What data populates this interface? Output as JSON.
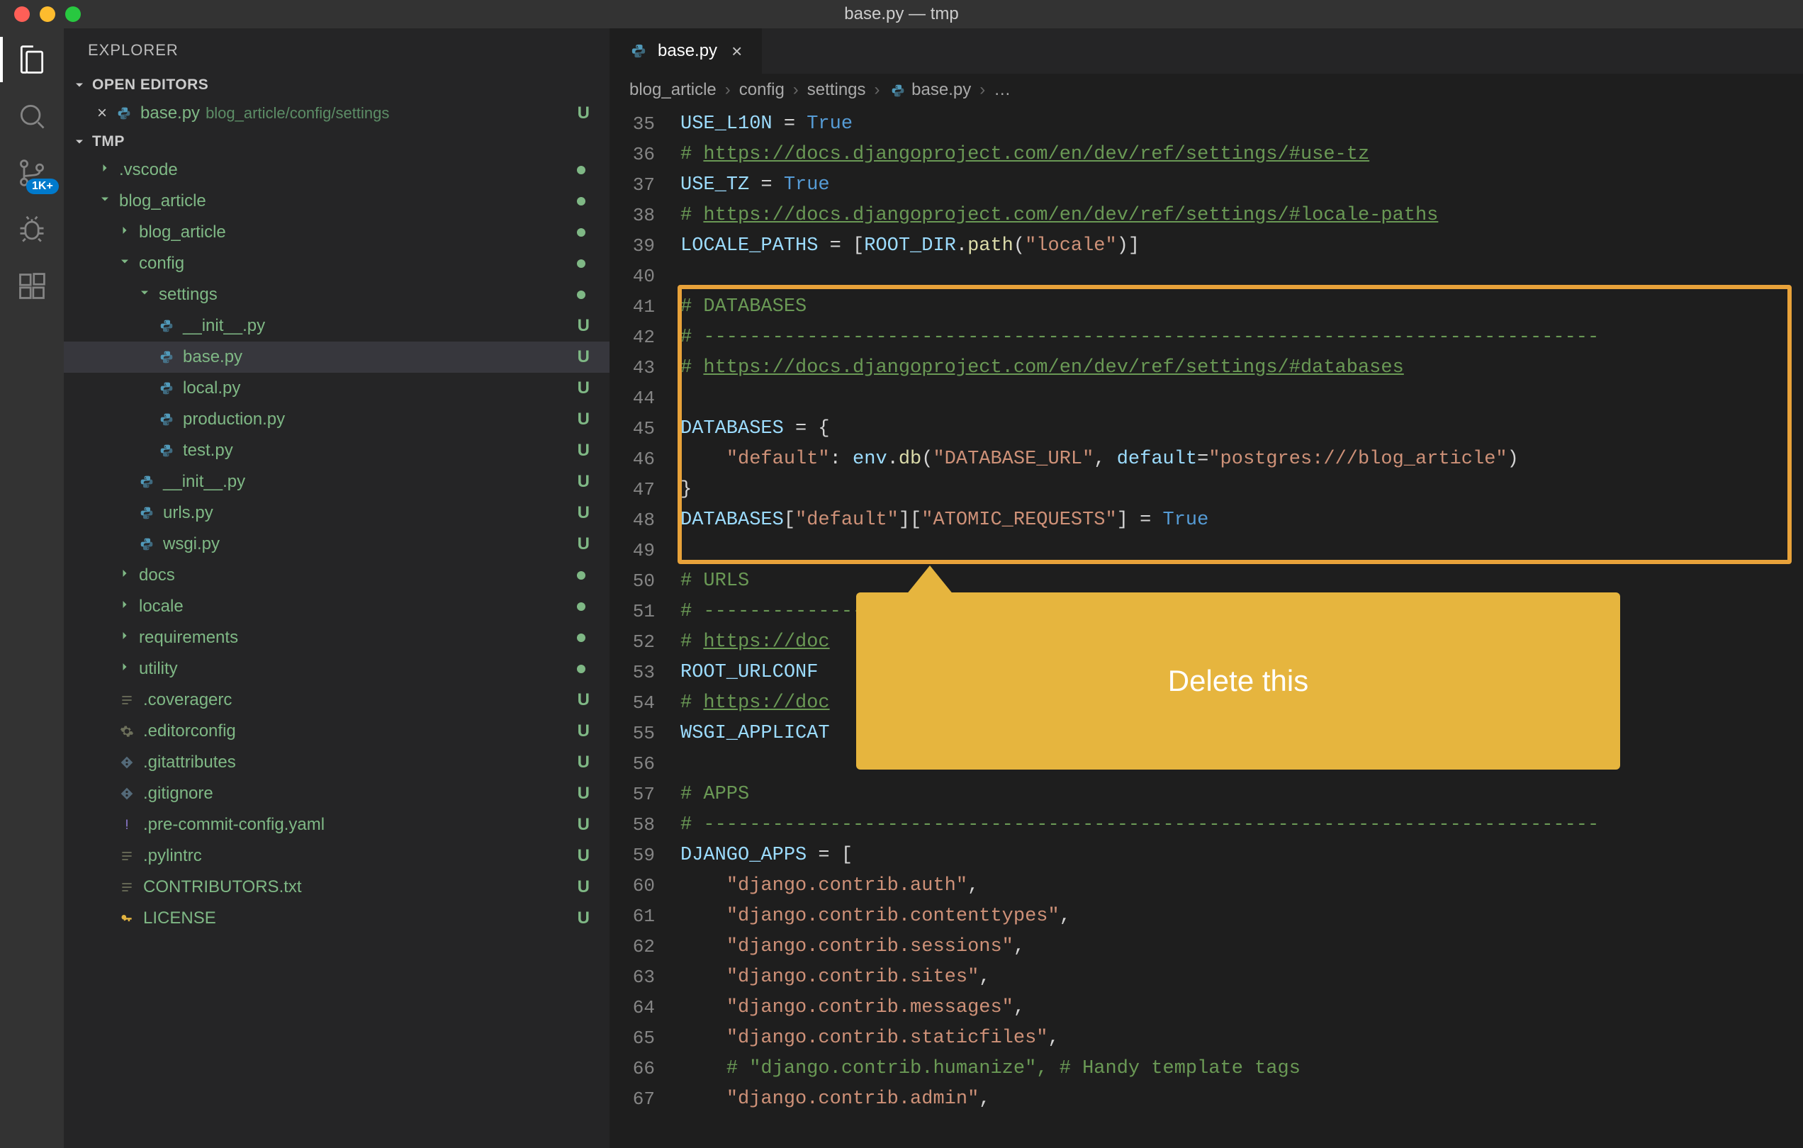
{
  "titlebar": {
    "title": "base.py — tmp"
  },
  "activity": {
    "badge_text": "1K+"
  },
  "sidebar": {
    "title": "EXPLORER",
    "open_editors_label": "OPEN EDITORS",
    "workspace_label": "TMP",
    "open_editor": {
      "name": "base.py",
      "path": "blog_article/config/settings",
      "status": "U"
    },
    "tree": [
      {
        "type": "folder",
        "name": ".vscode",
        "depth": 1,
        "expanded": false,
        "status_dot": true
      },
      {
        "type": "folder",
        "name": "blog_article",
        "depth": 1,
        "expanded": true,
        "status_dot": true
      },
      {
        "type": "folder",
        "name": "blog_article",
        "depth": 2,
        "expanded": false,
        "status_dot": true
      },
      {
        "type": "folder",
        "name": "config",
        "depth": 2,
        "expanded": true,
        "status_dot": true
      },
      {
        "type": "folder",
        "name": "settings",
        "depth": 3,
        "expanded": true,
        "status_dot": true
      },
      {
        "type": "file",
        "name": "__init__.py",
        "depth": 4,
        "icon": "py",
        "status": "U"
      },
      {
        "type": "file",
        "name": "base.py",
        "depth": 4,
        "icon": "py",
        "status": "U",
        "selected": true
      },
      {
        "type": "file",
        "name": "local.py",
        "depth": 4,
        "icon": "py",
        "status": "U"
      },
      {
        "type": "file",
        "name": "production.py",
        "depth": 4,
        "icon": "py",
        "status": "U"
      },
      {
        "type": "file",
        "name": "test.py",
        "depth": 4,
        "icon": "py",
        "status": "U"
      },
      {
        "type": "file",
        "name": "__init__.py",
        "depth": 3,
        "icon": "py",
        "status": "U"
      },
      {
        "type": "file",
        "name": "urls.py",
        "depth": 3,
        "icon": "py",
        "status": "U"
      },
      {
        "type": "file",
        "name": "wsgi.py",
        "depth": 3,
        "icon": "py",
        "status": "U"
      },
      {
        "type": "folder",
        "name": "docs",
        "depth": 2,
        "expanded": false,
        "status_dot": true
      },
      {
        "type": "folder",
        "name": "locale",
        "depth": 2,
        "expanded": false,
        "status_dot": true
      },
      {
        "type": "folder",
        "name": "requirements",
        "depth": 2,
        "expanded": false,
        "status_dot": true
      },
      {
        "type": "folder",
        "name": "utility",
        "depth": 2,
        "expanded": false,
        "status_dot": true
      },
      {
        "type": "file",
        "name": ".coveragerc",
        "depth": 2,
        "icon": "lines",
        "status": "U"
      },
      {
        "type": "file",
        "name": ".editorconfig",
        "depth": 2,
        "icon": "gear",
        "status": "U"
      },
      {
        "type": "file",
        "name": ".gitattributes",
        "depth": 2,
        "icon": "git",
        "status": "U"
      },
      {
        "type": "file",
        "name": ".gitignore",
        "depth": 2,
        "icon": "git",
        "status": "U"
      },
      {
        "type": "file",
        "name": ".pre-commit-config.yaml",
        "depth": 2,
        "icon": "exc",
        "status": "U"
      },
      {
        "type": "file",
        "name": ".pylintrc",
        "depth": 2,
        "icon": "lines",
        "status": "U"
      },
      {
        "type": "file",
        "name": "CONTRIBUTORS.txt",
        "depth": 2,
        "icon": "lines",
        "status": "U"
      },
      {
        "type": "file",
        "name": "LICENSE",
        "depth": 2,
        "icon": "key",
        "status": "U"
      }
    ]
  },
  "tab": {
    "label": "base.py"
  },
  "breadcrumbs": [
    "blog_article",
    "config",
    "settings",
    "base.py",
    "…"
  ],
  "code": {
    "first_line_no": 35,
    "lines": [
      [
        [
          "var",
          "USE_L10N"
        ],
        [
          "op",
          " = "
        ],
        [
          "num",
          "True"
        ]
      ],
      [
        [
          "cm",
          "# "
        ],
        [
          "link",
          "https://docs.djangoproject.com/en/dev/ref/settings/#use-tz"
        ]
      ],
      [
        [
          "var",
          "USE_TZ"
        ],
        [
          "op",
          " = "
        ],
        [
          "num",
          "True"
        ]
      ],
      [
        [
          "cm",
          "# "
        ],
        [
          "link",
          "https://docs.djangoproject.com/en/dev/ref/settings/#locale-paths"
        ]
      ],
      [
        [
          "var",
          "LOCALE_PATHS"
        ],
        [
          "op",
          " = ["
        ],
        [
          "var",
          "ROOT_DIR"
        ],
        [
          "op",
          "."
        ],
        [
          "func",
          "path"
        ],
        [
          "op",
          "("
        ],
        [
          "str",
          "\"locale\""
        ],
        [
          "op",
          ")]"
        ]
      ],
      [],
      [
        [
          "cm",
          "# DATABASES"
        ]
      ],
      [
        [
          "cm",
          "# ------------------------------------------------------------------------------"
        ]
      ],
      [
        [
          "cm",
          "# "
        ],
        [
          "link",
          "https://docs.djangoproject.com/en/dev/ref/settings/#databases"
        ]
      ],
      [],
      [
        [
          "var",
          "DATABASES"
        ],
        [
          "op",
          " = {"
        ]
      ],
      [
        [
          "op",
          "    "
        ],
        [
          "str",
          "\"default\""
        ],
        [
          "op",
          ": "
        ],
        [
          "var",
          "env"
        ],
        [
          "op",
          "."
        ],
        [
          "func",
          "db"
        ],
        [
          "op",
          "("
        ],
        [
          "str",
          "\"DATABASE_URL\""
        ],
        [
          "op",
          ", "
        ],
        [
          "param",
          "default"
        ],
        [
          "op",
          "="
        ],
        [
          "str",
          "\"postgres:///blog_article\""
        ],
        [
          "op",
          ")"
        ]
      ],
      [
        [
          "op",
          "}"
        ]
      ],
      [
        [
          "var",
          "DATABASES"
        ],
        [
          "op",
          "["
        ],
        [
          "str",
          "\"default\""
        ],
        [
          "op",
          "]["
        ],
        [
          "str",
          "\"ATOMIC_REQUESTS\""
        ],
        [
          "op",
          "] = "
        ],
        [
          "num",
          "True"
        ]
      ],
      [],
      [
        [
          "cm",
          "# URLS"
        ]
      ],
      [
        [
          "cm",
          "# ------------------------------------------------------------------------------"
        ]
      ],
      [
        [
          "cm",
          "# "
        ],
        [
          "link",
          "https://doc"
        ]
      ],
      [
        [
          "var",
          "ROOT_URLCONF "
        ]
      ],
      [
        [
          "cm",
          "# "
        ],
        [
          "link",
          "https://doc"
        ]
      ],
      [
        [
          "var",
          "WSGI_APPLICAT"
        ]
      ],
      [],
      [
        [
          "cm",
          "# APPS"
        ]
      ],
      [
        [
          "cm",
          "# ------------------------------------------------------------------------------"
        ]
      ],
      [
        [
          "var",
          "DJANGO_APPS"
        ],
        [
          "op",
          " = ["
        ]
      ],
      [
        [
          "op",
          "    "
        ],
        [
          "str",
          "\"django.contrib.auth\""
        ],
        [
          "op",
          ","
        ]
      ],
      [
        [
          "op",
          "    "
        ],
        [
          "str",
          "\"django.contrib.contenttypes\""
        ],
        [
          "op",
          ","
        ]
      ],
      [
        [
          "op",
          "    "
        ],
        [
          "str",
          "\"django.contrib.sessions\""
        ],
        [
          "op",
          ","
        ]
      ],
      [
        [
          "op",
          "    "
        ],
        [
          "str",
          "\"django.contrib.sites\""
        ],
        [
          "op",
          ","
        ]
      ],
      [
        [
          "op",
          "    "
        ],
        [
          "str",
          "\"django.contrib.messages\""
        ],
        [
          "op",
          ","
        ]
      ],
      [
        [
          "op",
          "    "
        ],
        [
          "str",
          "\"django.contrib.staticfiles\""
        ],
        [
          "op",
          ","
        ]
      ],
      [
        [
          "op",
          "    "
        ],
        [
          "cm",
          "# \"django.contrib.humanize\", # Handy template tags"
        ]
      ],
      [
        [
          "op",
          "    "
        ],
        [
          "str",
          "\"django.contrib.admin\""
        ],
        [
          "op",
          ","
        ]
      ]
    ]
  },
  "annotation": {
    "callout_text": "Delete this"
  }
}
